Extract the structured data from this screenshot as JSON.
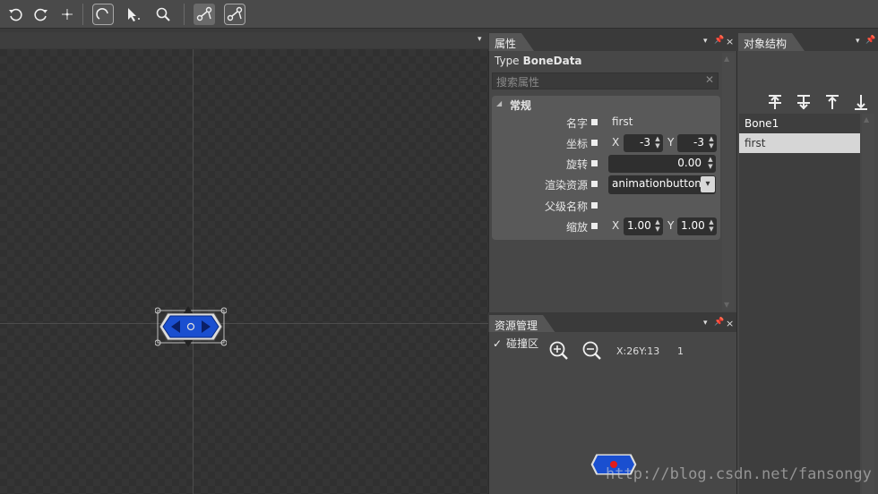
{
  "toolbar": {
    "icons": [
      "rotate-ccw-icon",
      "rotate-cw-icon",
      "move-icon",
      "arc-icon",
      "select-arrow-icon",
      "zoom-icon",
      "bone-icon",
      "bone-edit-icon"
    ]
  },
  "properties_panel": {
    "title": "属性",
    "type_label": "Type",
    "type_value": "BoneData",
    "search_placeholder": "搜索属性",
    "section_title": "常规",
    "rows": {
      "name": {
        "label": "名字",
        "value": "first"
      },
      "position": {
        "label": "坐标",
        "x_label": "X",
        "x_value": "-3",
        "y_label": "Y",
        "y_value": "-3"
      },
      "rotation": {
        "label": "旋转",
        "value": "0.00"
      },
      "render_resource": {
        "label": "渲染资源",
        "value": "animationbutton"
      },
      "parent_name": {
        "label": "父级名称",
        "value": ""
      },
      "scale": {
        "label": "缩放",
        "x_label": "X",
        "x_value": "1.00",
        "y_label": "Y",
        "y_value": "1.00"
      }
    }
  },
  "assets_panel": {
    "title": "资源管理",
    "collision_label": "碰撞区",
    "collision_checked": true,
    "coord_text": "X:26Y:13",
    "frame_text": "1"
  },
  "objects_panel": {
    "title": "对象结构",
    "items": [
      "Bone1",
      "first"
    ],
    "selected_index": 1
  },
  "watermark": "http://blog.csdn.net/fansongy",
  "colors": {
    "accent_blue": "#1a4fd0",
    "selected_row": "#d6d6d6",
    "red_dot": "#e11b1b"
  }
}
